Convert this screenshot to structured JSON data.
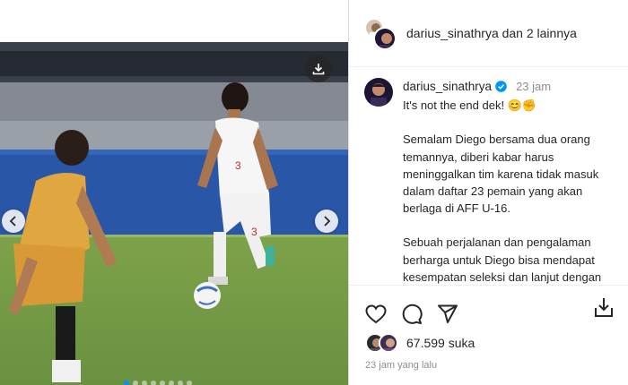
{
  "header": {
    "text": "darius_sinathrya dan 2 lainnya"
  },
  "post": {
    "username": "darius_sinathrya",
    "time": "23 jam",
    "caption": [
      "It's not the end dek! 😊✊",
      "Semalam Diego bersama dua orang temannya, diberi kabar harus meninggalkan tim karena tidak masuk dalam daftar 23 pemain yang akan berlaga di AFF U-16.",
      "Sebuah perjalanan dan pengalaman berharga untuk Diego bisa mendapat kesempatan seleksi dan lanjut dengan"
    ]
  },
  "stats": {
    "likes": "67.599 suka",
    "posted": "23 jam yang lalu"
  },
  "media": {
    "slide_count": 8,
    "active_slide": 0
  },
  "colors": {
    "verified": "#0095f6",
    "text": "#262626",
    "muted": "#8e8e8e"
  }
}
